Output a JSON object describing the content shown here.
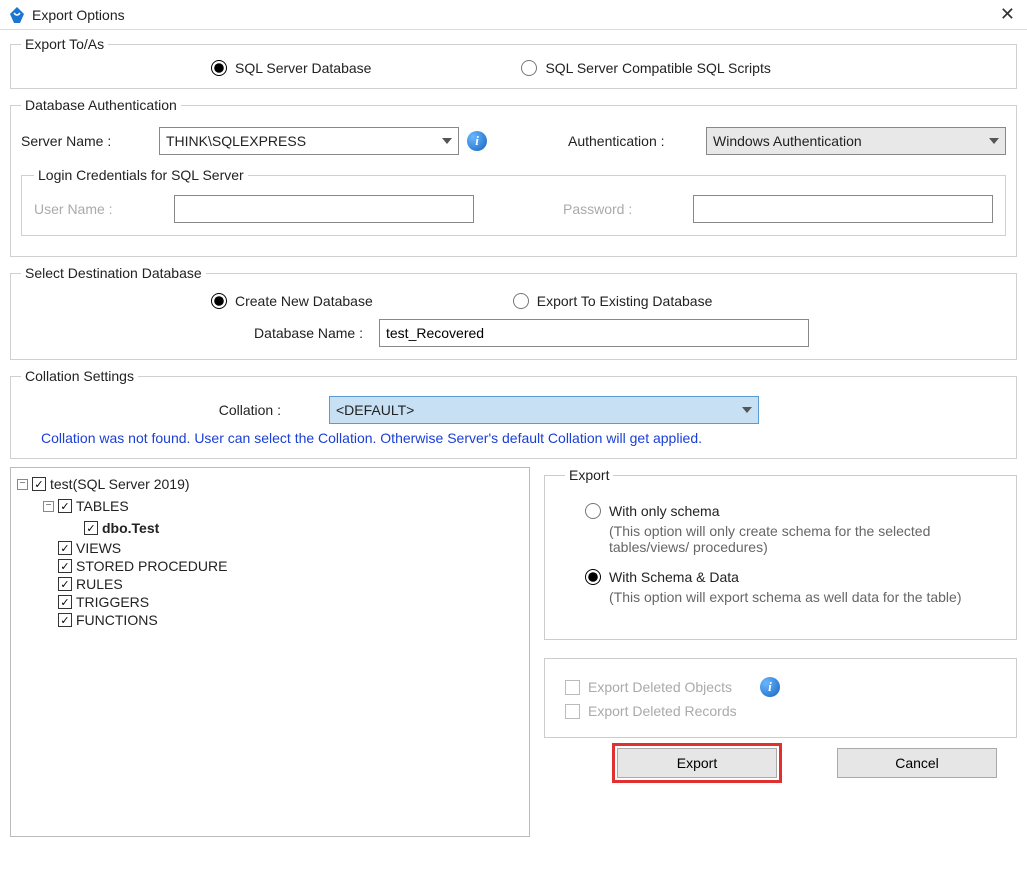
{
  "window": {
    "title": "Export Options"
  },
  "exportTo": {
    "legend": "Export To/As",
    "opt1": "SQL Server Database",
    "opt2": "SQL Server Compatible SQL Scripts"
  },
  "auth": {
    "legend": "Database Authentication",
    "serverLabel": "Server Name :",
    "serverValue": "THINK\\SQLEXPRESS",
    "authLabel": "Authentication :",
    "authValue": "Windows Authentication",
    "loginLegend": "Login Credentials for SQL Server",
    "userLabel": "User Name :",
    "passLabel": "Password :"
  },
  "dest": {
    "legend": "Select Destination Database",
    "opt1": "Create New Database",
    "opt2": "Export To Existing Database",
    "dbLabel": "Database Name :",
    "dbValue": "test_Recovered"
  },
  "coll": {
    "legend": "Collation Settings",
    "label": "Collation :",
    "value": "<DEFAULT>",
    "note": "Collation was not found. User can select the Collation. Otherwise Server's default Collation will get applied."
  },
  "tree": {
    "root": "test(SQL Server 2019)",
    "tables": "TABLES",
    "table1": "dbo.Test",
    "views": "VIEWS",
    "sp": "STORED PROCEDURE",
    "rules": "RULES",
    "triggers": "TRIGGERS",
    "functions": "FUNCTIONS"
  },
  "export": {
    "legend": "Export",
    "opt1": "With only schema",
    "desc1": "(This option will only create schema for the  selected tables/views/ procedures)",
    "opt2": "With Schema & Data",
    "desc2": "(This option will export schema as well data for the table)"
  },
  "del": {
    "opt1": "Export Deleted Objects",
    "opt2": "Export Deleted Records"
  },
  "buttons": {
    "export": "Export",
    "cancel": "Cancel"
  }
}
